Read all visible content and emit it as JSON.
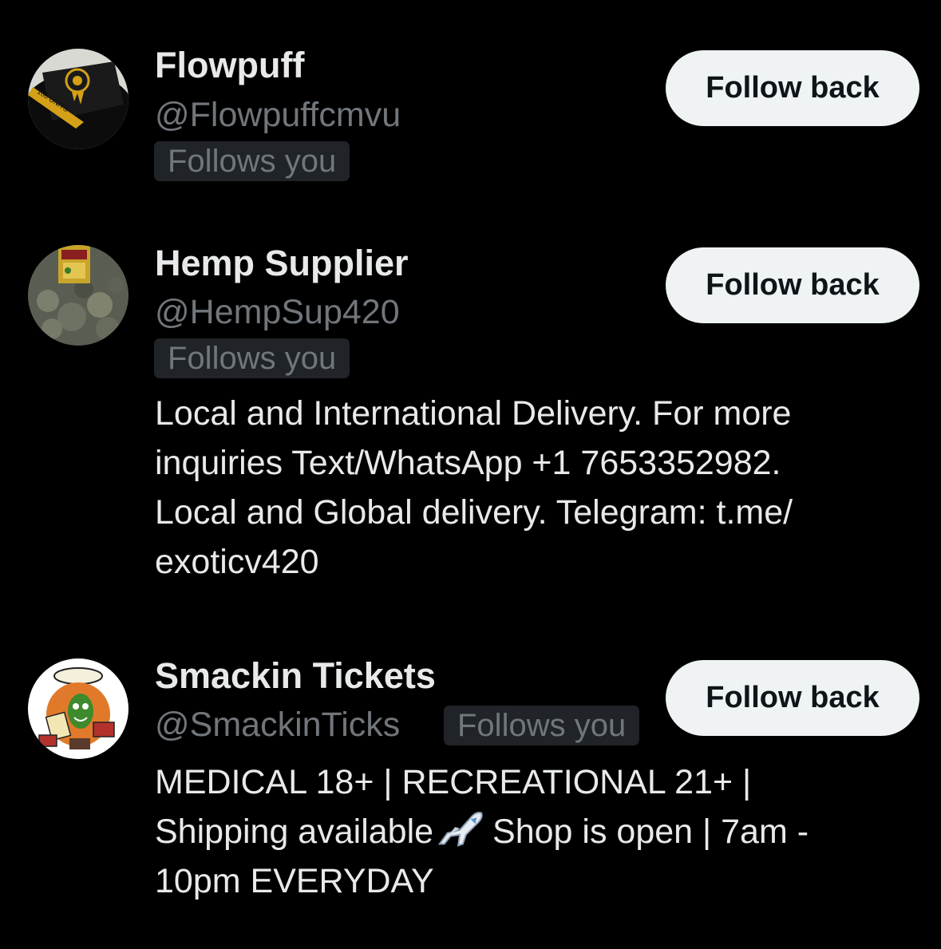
{
  "users": [
    {
      "display_name": "Flowpuff",
      "handle": "@Flowpuffcmvu",
      "follows_you": "Follows you",
      "button_label": "Follow back",
      "avatar_icon": "dark-box-avatar",
      "avatar_text": "100 UNITS"
    },
    {
      "display_name": "Hemp Supplier",
      "handle": "@HempSup420",
      "follows_you": "Follows you",
      "button_label": "Follow back",
      "avatar_icon": "cannabis-jar-avatar",
      "bio_lines": [
        "Local and International Delivery. For more",
        "inquiries Text/WhatsApp +1 7653352982.",
        "Local and Global delivery. Telegram: t.me/",
        "exoticv420"
      ]
    },
    {
      "display_name": "Smackin Tickets",
      "handle": "@SmackinTicks",
      "follows_you": "Follows you",
      "button_label": "Follow back",
      "avatar_icon": "cartoon-character-avatar",
      "bio_lines": [
        "MEDICAL 18+ | RECREATIONAL 21+ |",
        "Shipping available",
        "Shop is open | 7am -",
        "10pm EVERYDAY"
      ],
      "bio_emoji": "airplane-icon"
    }
  ],
  "colors": {
    "background": "#000000",
    "primary_text": "#e7e9ea",
    "secondary_text": "#71767b",
    "badge_bg": "#202327",
    "button_bg": "#eff3f4",
    "button_text": "#0f1419"
  }
}
